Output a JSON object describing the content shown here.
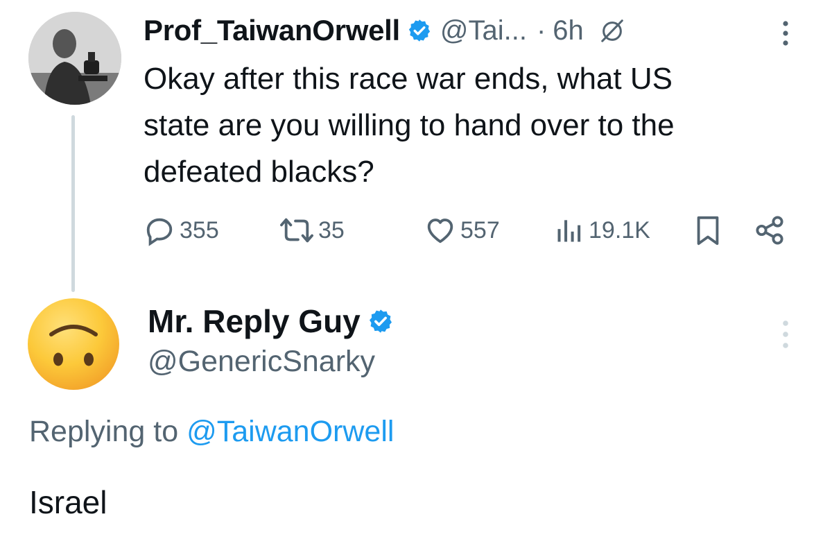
{
  "tweet": {
    "author_name": "Prof_TaiwanOrwell",
    "handle_truncated": "@Tai...",
    "separator": "·",
    "time": "6h",
    "text_lines": [
      "Okay after this race war ends, what US",
      "state are you willing to hand over to the",
      "defeated blacks?"
    ],
    "stats": {
      "replies": "355",
      "reposts": "35",
      "likes": "557",
      "views": "19.1K"
    }
  },
  "reply": {
    "author_name": "Mr. Reply Guy",
    "handle": "@GenericSnarky",
    "replying_prefix": "Replying to",
    "replying_handle": "@TaiwanOrwell",
    "text": "Israel"
  },
  "icons": {
    "verified": "verified-badge-icon",
    "grok": "grok-icon",
    "more": "more-options-icon",
    "reply": "reply-icon",
    "repost": "repost-icon",
    "like": "heart-icon",
    "views": "views-chart-icon",
    "bookmark": "bookmark-icon",
    "share": "share-icon"
  },
  "colors": {
    "accent": "#1d9bf0",
    "text_primary": "#0f1419",
    "text_secondary": "#536471",
    "thread_line": "#cfd9de"
  }
}
